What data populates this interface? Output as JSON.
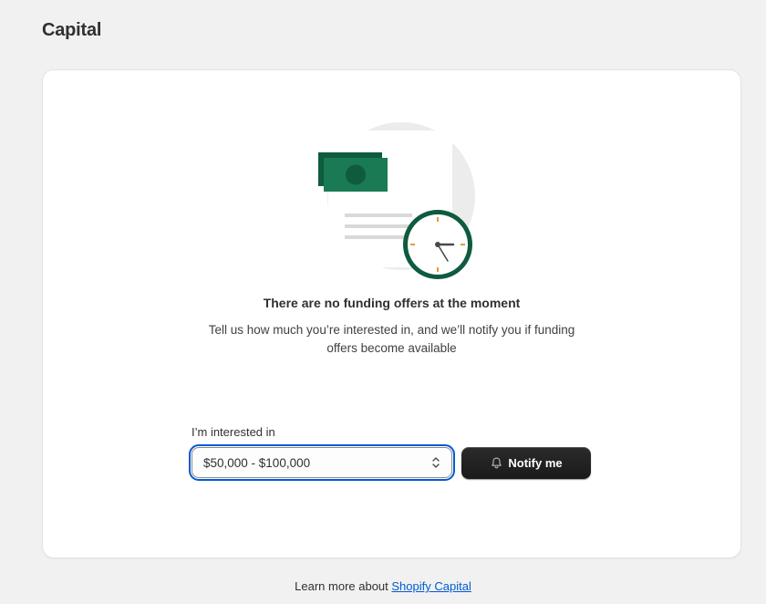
{
  "page": {
    "title": "Capital"
  },
  "empty_state": {
    "heading": "There are no funding offers at the moment",
    "description": "Tell us how much you’re interested in, and we’ll notify you if funding offers become available"
  },
  "form": {
    "label": "I’m interested in",
    "selected_value": "$50,000 - $100,000",
    "notify_button": "Notify me"
  },
  "footer": {
    "prefix": "Learn more about ",
    "link_text": "Shopify Capital"
  },
  "colors": {
    "accent_green": "#1a7a53",
    "focus_blue": "#005bd3",
    "button_dark": "#1a1a1a"
  },
  "icons": [
    "document-money-clock-illustration",
    "select-chevron-icon",
    "bell-icon"
  ]
}
